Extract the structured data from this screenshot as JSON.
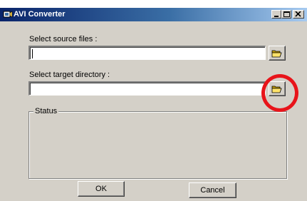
{
  "window": {
    "title": "AVI Converter",
    "icon": "avi-app-icon"
  },
  "titlebar_buttons": [
    {
      "name": "minimize",
      "icon": "minimize-icon"
    },
    {
      "name": "maximize",
      "icon": "maximize-icon"
    },
    {
      "name": "close",
      "icon": "close-icon"
    }
  ],
  "source": {
    "label": "Select source files :",
    "value": "",
    "browse_icon": "folder-open-icon"
  },
  "target": {
    "label": "Select target directory :",
    "value": "",
    "browse_icon": "folder-open-icon"
  },
  "status": {
    "legend": "Status"
  },
  "buttons": {
    "ok": "OK",
    "cancel": "Cancel"
  },
  "colors": {
    "dialog_face": "#d4d0c8",
    "titlebar_start": "#0a246a",
    "titlebar_end": "#a6caf0",
    "annotation": "#e8141a"
  }
}
